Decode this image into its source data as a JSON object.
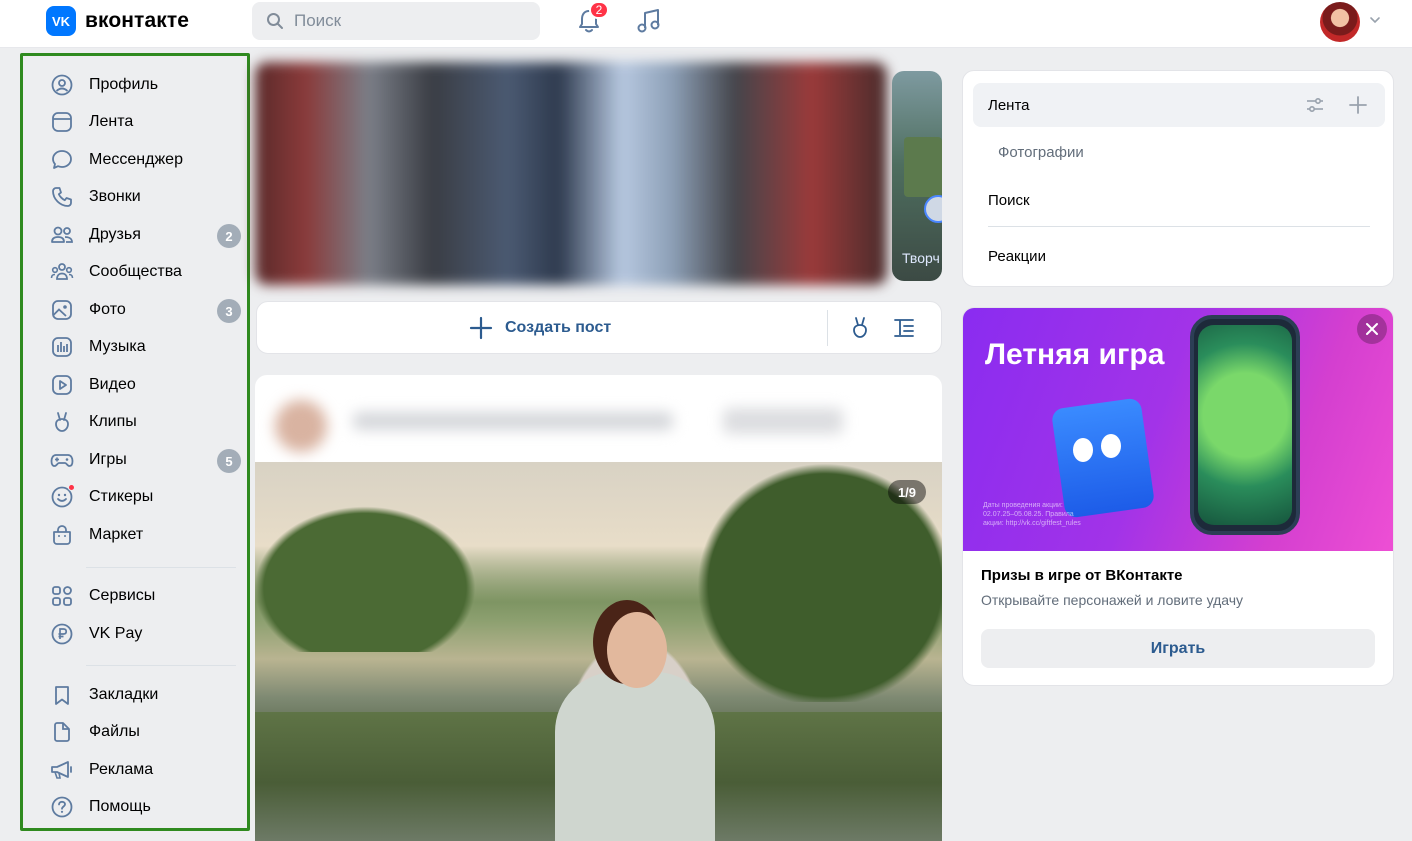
{
  "header": {
    "logo_text": "вконтакте",
    "logo_mark": "VK",
    "search_placeholder": "Поиск",
    "notifications_count": "2"
  },
  "sidebar": {
    "items": [
      {
        "label": "Профиль",
        "icon": "profile-icon"
      },
      {
        "label": "Лента",
        "icon": "feed-icon"
      },
      {
        "label": "Мессенджер",
        "icon": "messenger-icon"
      },
      {
        "label": "Звонки",
        "icon": "phone-icon"
      },
      {
        "label": "Друзья",
        "icon": "friends-icon",
        "count": "2"
      },
      {
        "label": "Сообщества",
        "icon": "communities-icon"
      },
      {
        "label": "Фото",
        "icon": "photo-icon",
        "count": "3"
      },
      {
        "label": "Музыка",
        "icon": "music-icon"
      },
      {
        "label": "Видео",
        "icon": "video-icon"
      },
      {
        "label": "Клипы",
        "icon": "clips-icon"
      },
      {
        "label": "Игры",
        "icon": "games-icon",
        "count": "5"
      },
      {
        "label": "Стикеры",
        "icon": "stickers-icon"
      },
      {
        "label": "Маркет",
        "icon": "market-icon"
      },
      {
        "label": "Сервисы",
        "icon": "services-icon"
      },
      {
        "label": "VK Pay",
        "icon": "vkpay-icon"
      },
      {
        "label": "Закладки",
        "icon": "bookmarks-icon"
      },
      {
        "label": "Файлы",
        "icon": "files-icon"
      },
      {
        "label": "Реклама",
        "icon": "ads-icon"
      },
      {
        "label": "Помощь",
        "icon": "help-icon"
      }
    ]
  },
  "stories": {
    "partial_label": "Творч"
  },
  "create_post": {
    "label": "Создать пост"
  },
  "post": {
    "photo_counter": "1/9"
  },
  "right_nav": {
    "active": "Лента",
    "sub": "Фотографии",
    "items": [
      "Поиск",
      "Реакции"
    ]
  },
  "promo": {
    "banner_title": "Летняя игра",
    "banner_small": "Даты проведения акции: 02.07.25–05.08.25. Правила акции: http://vk.cc/giftfest_rules",
    "title": "Призы в игре от ВКонтакте",
    "desc": "Открывайте персонажей и ловите удачу",
    "button": "Играть"
  },
  "colors": {
    "accent": "#0077ff",
    "link": "#2c5b8f",
    "sidebar_border": "#2f8a1f",
    "badge_red": "#ff3347",
    "count_gray": "#a3adb8"
  }
}
